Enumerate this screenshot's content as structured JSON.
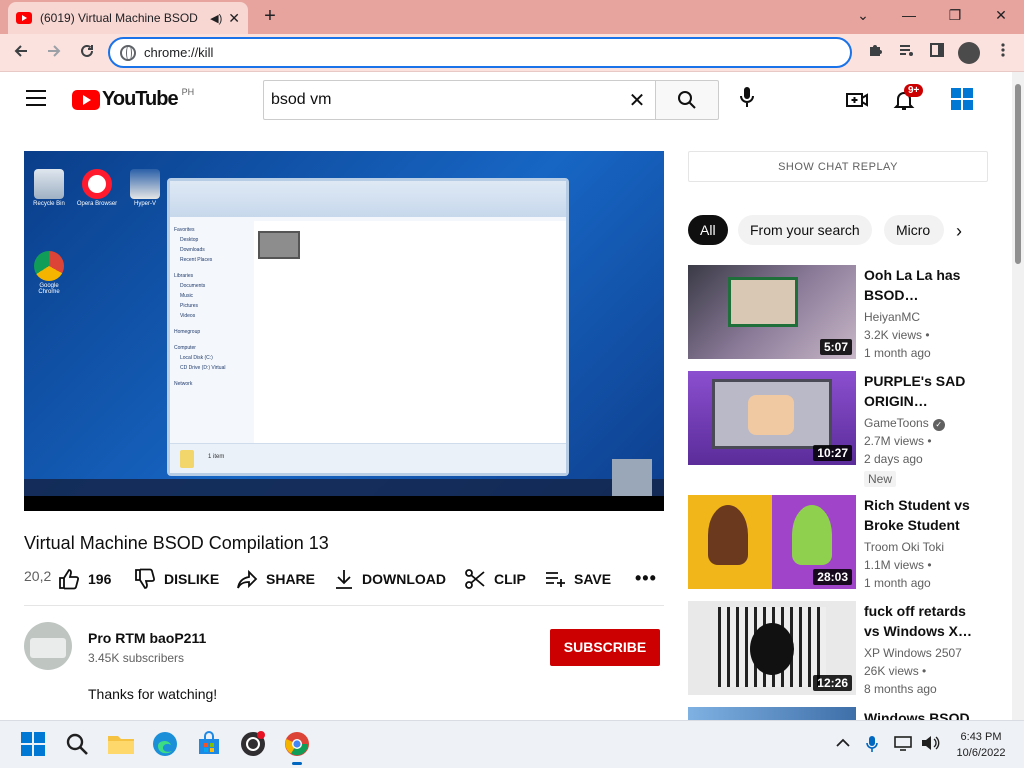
{
  "browser": {
    "tab_title": "(6019) Virtual Machine BSOD",
    "tab_speaker": "◀)",
    "tab_close": "✕",
    "new_tab": "+",
    "url": "chrome://kill",
    "window_controls": {
      "chevron": "⌄",
      "minimize": "—",
      "restore": "❐",
      "close": "✕"
    }
  },
  "yt": {
    "logo_text": "YouTube",
    "region": "PH",
    "search_query": "bsod vm",
    "notification_count": "9+"
  },
  "video": {
    "title": "Virtual Machine BSOD Compilation 13",
    "views_prefix": "20,2",
    "like_count": "196",
    "actions": {
      "dislike": "DISLIKE",
      "share": "SHARE",
      "download": "DOWNLOAD",
      "clip": "CLIP",
      "save": "SAVE"
    },
    "more": "•••",
    "desktop_icons": [
      "Recycle Bin",
      "Opera Browser",
      "Hyper-V",
      "Google Chrome"
    ],
    "explorer_nav": [
      "Favorites",
      "Desktop",
      "Downloads",
      "Recent Places",
      "Libraries",
      "Documents",
      "Music",
      "Pictures",
      "Videos",
      "Homegroup",
      "Computer",
      "Local Disk (C:)",
      "CD Drive (D:) Virtual",
      "Network"
    ],
    "explorer_status": "1 item"
  },
  "channel": {
    "name": "Pro RTM baoP211",
    "subscribers": "3.45K subscribers",
    "subscribe_label": "SUBSCRIBE",
    "description": "Thanks for watching!"
  },
  "sidebar": {
    "chat_replay": "SHOW CHAT REPLAY",
    "chips": [
      "All",
      "From your search",
      "Micro"
    ],
    "recommendations": [
      {
        "title": "Ooh La La has BSOD…",
        "channel": "HeiyanMC",
        "views": "3.2K views •",
        "age": "1 month ago",
        "duration": "5:07"
      },
      {
        "title": "PURPLE's SAD ORIGIN…",
        "channel": "GameToons",
        "views": "2.7M views •",
        "age": "2 days ago",
        "duration": "10:27",
        "badge": "New"
      },
      {
        "title": "Rich Student vs Broke Student",
        "channel": "Troom Oki Toki",
        "views": "1.1M views •",
        "age": "1 month ago",
        "duration": "28:03"
      },
      {
        "title": "fuck off retards vs Windows X…",
        "channel": "XP Windows 2507",
        "views": "26K views •",
        "age": "8 months ago",
        "duration": "12:26"
      },
      {
        "title": "Windows BSOD"
      }
    ]
  },
  "taskbar": {
    "time": "6:43 PM",
    "date": "10/6/2022"
  },
  "colors": {
    "accent_red": "#cc0000",
    "omnibox_focus": "#1a73e8",
    "tab_strip": "#e7a49e"
  }
}
